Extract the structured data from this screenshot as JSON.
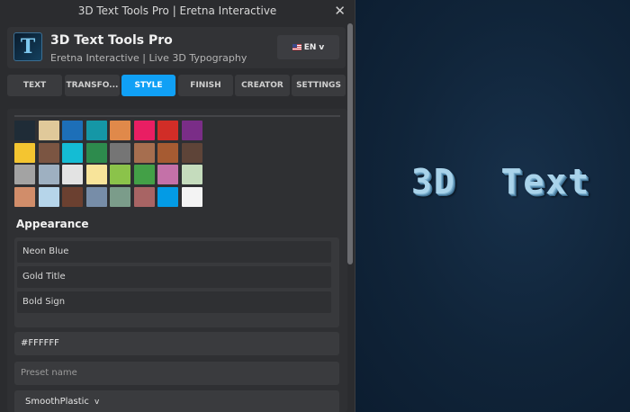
{
  "window": {
    "title": "3D Text Tools Pro | Eretna Interactive",
    "close_glyph": "✕"
  },
  "header": {
    "logo_letter": "T",
    "title": "3D Text Tools Pro",
    "subtitle": "Eretna Interactive | Live 3D Typography",
    "language": "EN",
    "language_chevron": "v"
  },
  "tabs": [
    {
      "label": "TEXT",
      "active": false
    },
    {
      "label": "TRANSFO...",
      "active": false
    },
    {
      "label": "STYLE",
      "active": true
    },
    {
      "label": "FINISH",
      "active": false
    },
    {
      "label": "CREATOR",
      "active": false
    },
    {
      "label": "SETTINGS",
      "active": false
    }
  ],
  "palette": [
    [
      "#1f2c37",
      "#e0c99a",
      "#1d6fb8",
      "#1597a6",
      "#e0894a",
      "#e91e63",
      "#d12d27",
      "#7a2d87"
    ],
    [
      "#f4c530",
      "#7b5542",
      "#14bcd4",
      "#2d8b4d",
      "#757575",
      "#a66e4f",
      "#a65b32",
      "#5e4438"
    ],
    [
      "#a3a3a3",
      "#9eb0c1",
      "#e3e3e3",
      "#f8e49a",
      "#8bc34a",
      "#43a047",
      "#c471a8",
      "#c5dcbd"
    ],
    [
      "#d18d6a",
      "#b6d5ea",
      "#6b4030",
      "#778da8",
      "#7b9c8a",
      "#a86464",
      "#039be5",
      "#f3f3f3"
    ]
  ],
  "appearance": {
    "title": "Appearance",
    "presets": [
      "Neon Blue",
      "Gold Title",
      "Bold Sign"
    ]
  },
  "color_hex": "#FFFFFF",
  "preset_name_placeholder": "Preset name",
  "material": {
    "selected": "SmoothPlastic",
    "chevron": "v"
  },
  "viewport": {
    "preview_text": "3D  Text"
  }
}
